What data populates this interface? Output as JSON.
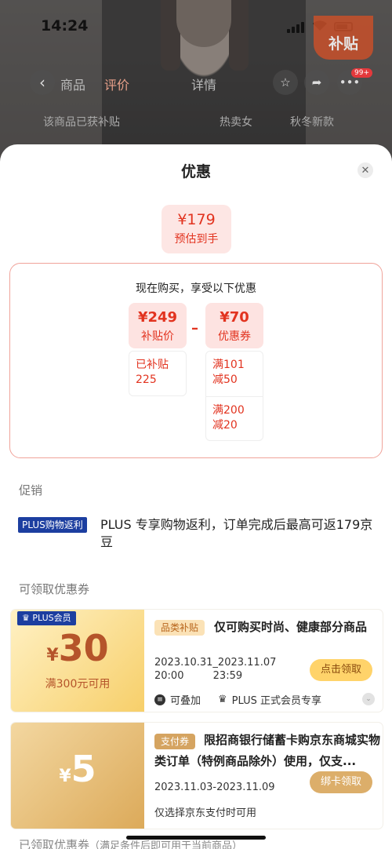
{
  "status_bar": {
    "time": "14:24"
  },
  "background_page": {
    "subsidy_tag": "补贴",
    "tabs": [
      "商品",
      "评价",
      "详情"
    ],
    "badge": "99+",
    "search_hints": [
      "该商品已获补贴",
      "热卖女",
      "秋冬新款"
    ]
  },
  "sheet": {
    "title": "优惠",
    "estimate": {
      "price": "¥179",
      "label": "预估到手"
    },
    "calc": {
      "title": "现在购买，享受以下优惠",
      "subsidy_price": {
        "value": "¥249",
        "label": "补贴价"
      },
      "coupon_total": {
        "value": "¥70",
        "label": "优惠券"
      },
      "subsidized": "已补贴\n225",
      "coupon_rule_1": "满101\n减50",
      "coupon_rule_2": "满200\n减20",
      "minus": "–"
    },
    "promo": {
      "section_label": "促销",
      "tag": "PLUS购物返利",
      "text": "PLUS 专享购物返利，订单完成后最高可返179京豆"
    },
    "coupons": {
      "section_label": "可领取优惠券",
      "items": [
        {
          "member_tag": "PLUS会员",
          "currency": "¥",
          "amount": "30",
          "condition": "满300元可用",
          "tag": "品类补贴",
          "desc": "仅可购买时尚、健康部分商品",
          "date": "2023.10.31_2023.11.07\n20:00         23:59",
          "button": "点击领取",
          "note_stackable": "可叠加",
          "note_plus": "PLUS 正式会员专享"
        },
        {
          "currency": "¥",
          "amount": "5",
          "tag": "支付券",
          "desc": "限招商银行储蓄卡购京东商城实物类订单（特例商品除外）使用，仅支...",
          "date": "2023.11.03-2023.11.09",
          "button": "绑卡领取",
          "note": "仅选择京东支付时可用"
        }
      ]
    },
    "received_label": "已领取优惠券",
    "received_hint": "（满足条件后即可用于当前商品）"
  },
  "colors": {
    "accent": "#e2331f",
    "plus_blue": "#1c3ea0",
    "gold": "#f7cf6a"
  }
}
